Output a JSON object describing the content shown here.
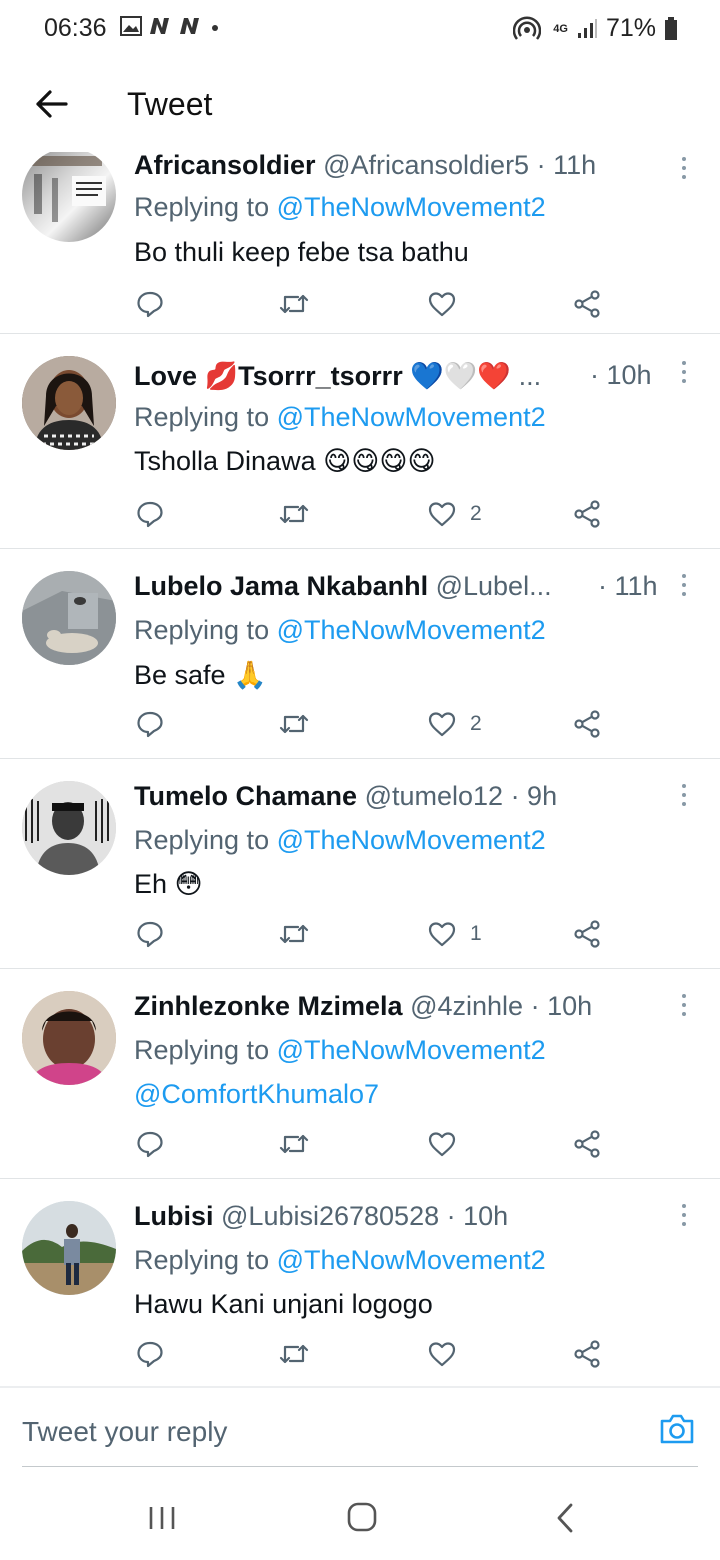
{
  "status_bar": {
    "time": "06:36",
    "battery": "71%",
    "network": "4G",
    "icons": [
      "gallery-icon",
      "n-icon",
      "n-icon",
      "dot-icon",
      "hotspot-icon",
      "signal-icon",
      "battery-icon"
    ]
  },
  "header": {
    "title": "Tweet",
    "back_icon": "arrow-left-icon"
  },
  "replies": [
    {
      "name": "Africansoldier",
      "handle": "@Africansoldier5",
      "time": "· 11h",
      "replying_prefix": "Replying to ",
      "replying_to": "@TheNowMovement2",
      "text": "Bo thuli keep febe tsa bathu",
      "likes": "",
      "liked": false
    },
    {
      "name": "Love 💋Tsorrr_tsorrr 💙🤍❤️",
      "handle": "...",
      "time": "· 10h",
      "replying_prefix": "Replying to ",
      "replying_to": "@TheNowMovement2",
      "text": "Tsholla Dinawa 😋😋😋😋",
      "likes": "2",
      "liked": false
    },
    {
      "name": "Lubelo Jama Nkabanhl",
      "handle": "@Lubel...",
      "time": "· 11h",
      "replying_prefix": "Replying to ",
      "replying_to": "@TheNowMovement2",
      "text": "Be safe 🙏",
      "likes": "2",
      "liked": false
    },
    {
      "name": "Tumelo Chamane",
      "handle": "@tumelo12",
      "time": "· 9h",
      "replying_prefix": "Replying to ",
      "replying_to": "@TheNowMovement2",
      "text": "Eh 😳",
      "likes": "1",
      "liked": false
    },
    {
      "name": "Zinhlezonke Mzimela",
      "handle": "@4zinhle",
      "time": "· 10h",
      "replying_prefix": "Replying to ",
      "replying_to": "@TheNowMovement2",
      "text": "@ComfortKhumalo7",
      "likes": "",
      "liked": false
    },
    {
      "name": "Lubisi",
      "handle": "@Lubisi26780528",
      "time": "· 10h",
      "replying_prefix": "Replying to ",
      "replying_to": "@TheNowMovement2",
      "text": "Hawu Kani unjani logogo",
      "likes": "",
      "liked": false
    }
  ],
  "action_icons": [
    "reply-icon",
    "retweet-icon",
    "like-icon",
    "share-icon"
  ],
  "reply_bar": {
    "placeholder": "Tweet your reply",
    "camera_icon": "camera-icon"
  },
  "nav_bar": {
    "icons": [
      "recent-apps-icon",
      "home-icon",
      "back-icon"
    ]
  },
  "colors": {
    "accent": "#1d9bf0",
    "text_primary": "#0f1419",
    "text_secondary": "#536471",
    "divider": "#e1e4e6"
  }
}
